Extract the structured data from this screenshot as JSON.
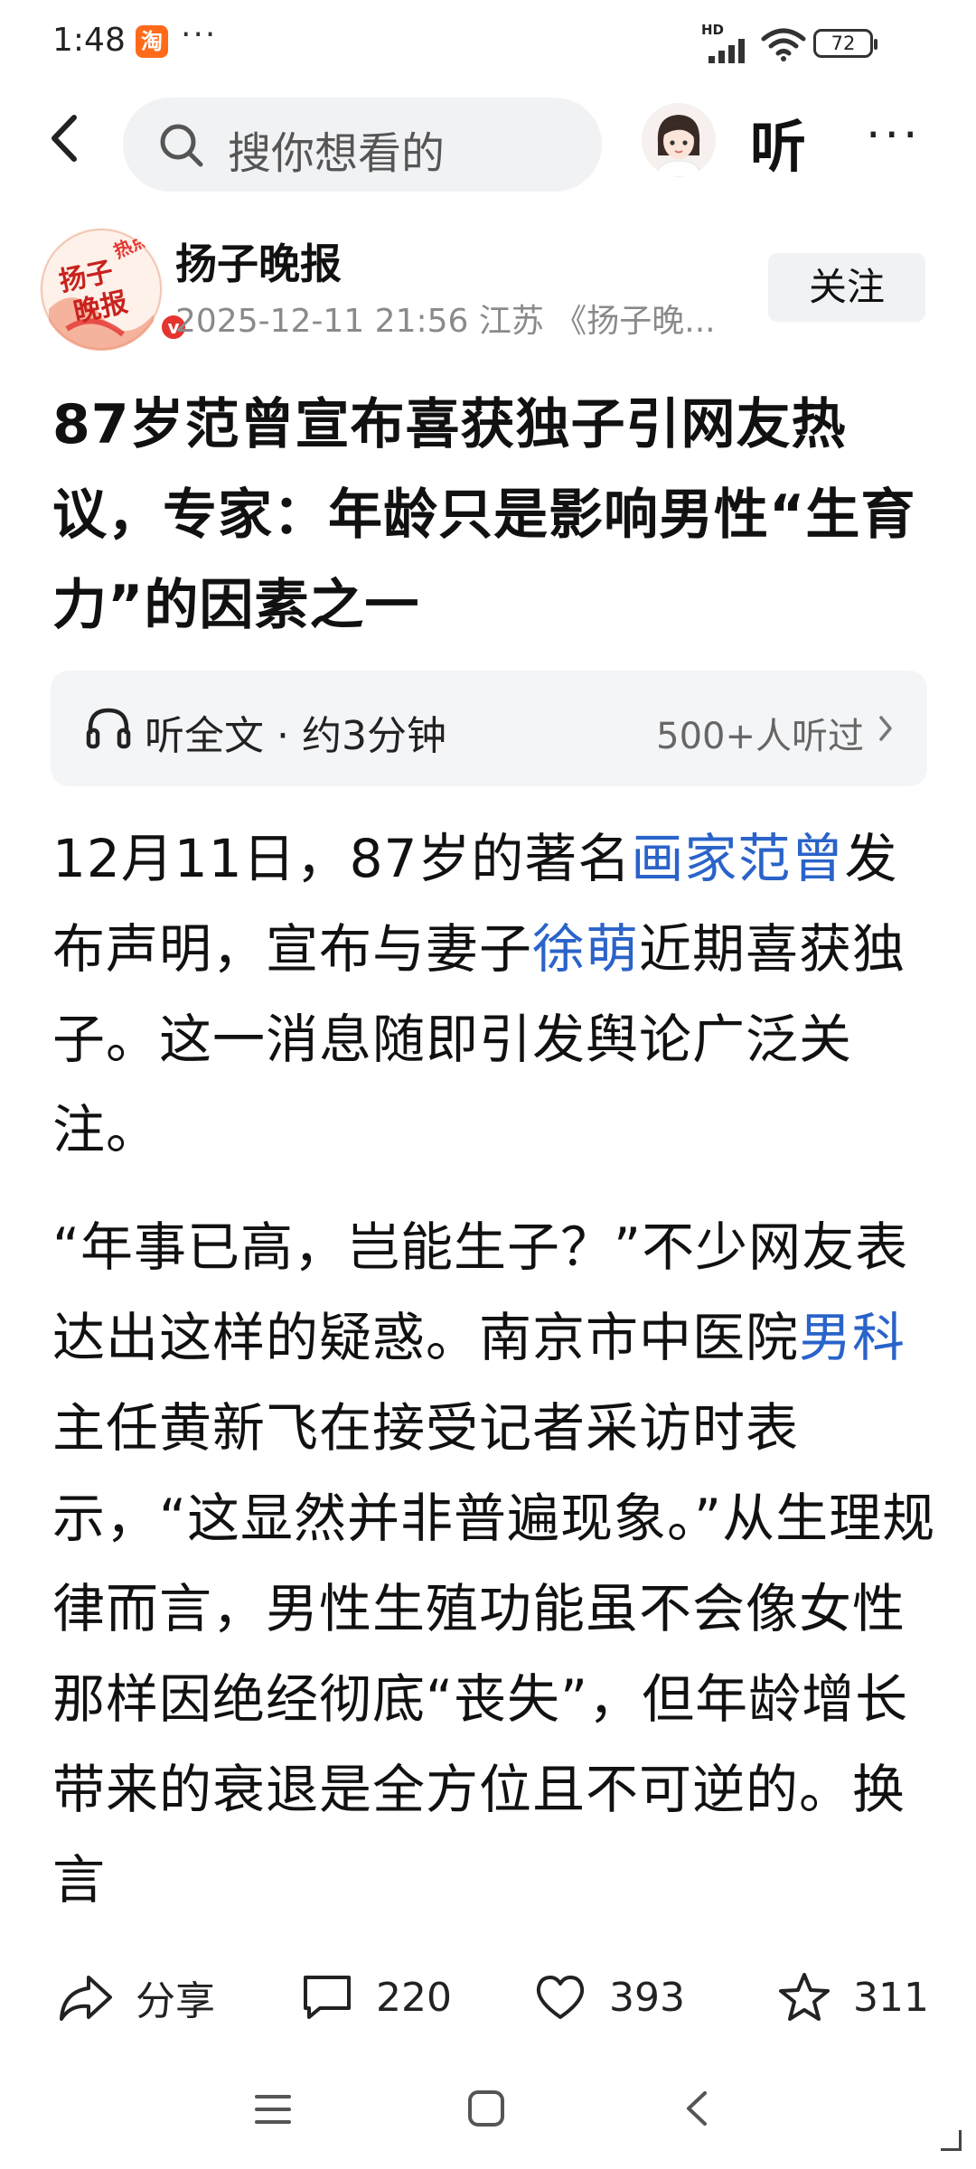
{
  "status_bar": {
    "time": "1:48",
    "app_badge": "淘",
    "more": "···",
    "hd": "HD",
    "battery": "72"
  },
  "top_bar": {
    "search_placeholder": "搜你想看的",
    "listen_label": "听",
    "more_label": "···"
  },
  "author": {
    "name": "扬子晚报",
    "meta": "2025-12-11 21:56  江苏  《扬子晚...",
    "follow_label": "关注",
    "logo_text_1": "热点侠",
    "logo_text_2": "扬子",
    "logo_text_3": "晚报"
  },
  "article": {
    "title": "87岁范曾宣布喜获独子引网友热议，专家：年龄只是影响男性“生育力”的因素之一",
    "listen_bar": {
      "label": "听全文 · 约3分钟",
      "count": "500+人听过"
    },
    "p1": {
      "a": "12月11日，87岁的著名",
      "link1": "画家范曾",
      "b": "发布声明，宣布与妻子",
      "link2": "徐萌",
      "c": "近期喜获独子。这一消息随即引发舆论广泛关注。"
    },
    "p2": {
      "a": "“年事已高，岂能生子？”不少网友表达出这样的疑惑。南京市中医院",
      "link1": "男科",
      "b": "主任黄新飞在接受记者采访时表示，“这显然并非普遍现象。”从生理规律而言，男性生殖功能虽不会像女性那样因绝经彻底“丧失”，但年龄增长带来的衰退是全方位且不可逆的。换言"
    }
  },
  "actions": {
    "share": "分享",
    "comments": "220",
    "likes": "393",
    "favorites": "311"
  },
  "colors": {
    "link": "#2a63c9",
    "brand_red": "#e5342f",
    "search_bg": "#f1f2f4"
  }
}
